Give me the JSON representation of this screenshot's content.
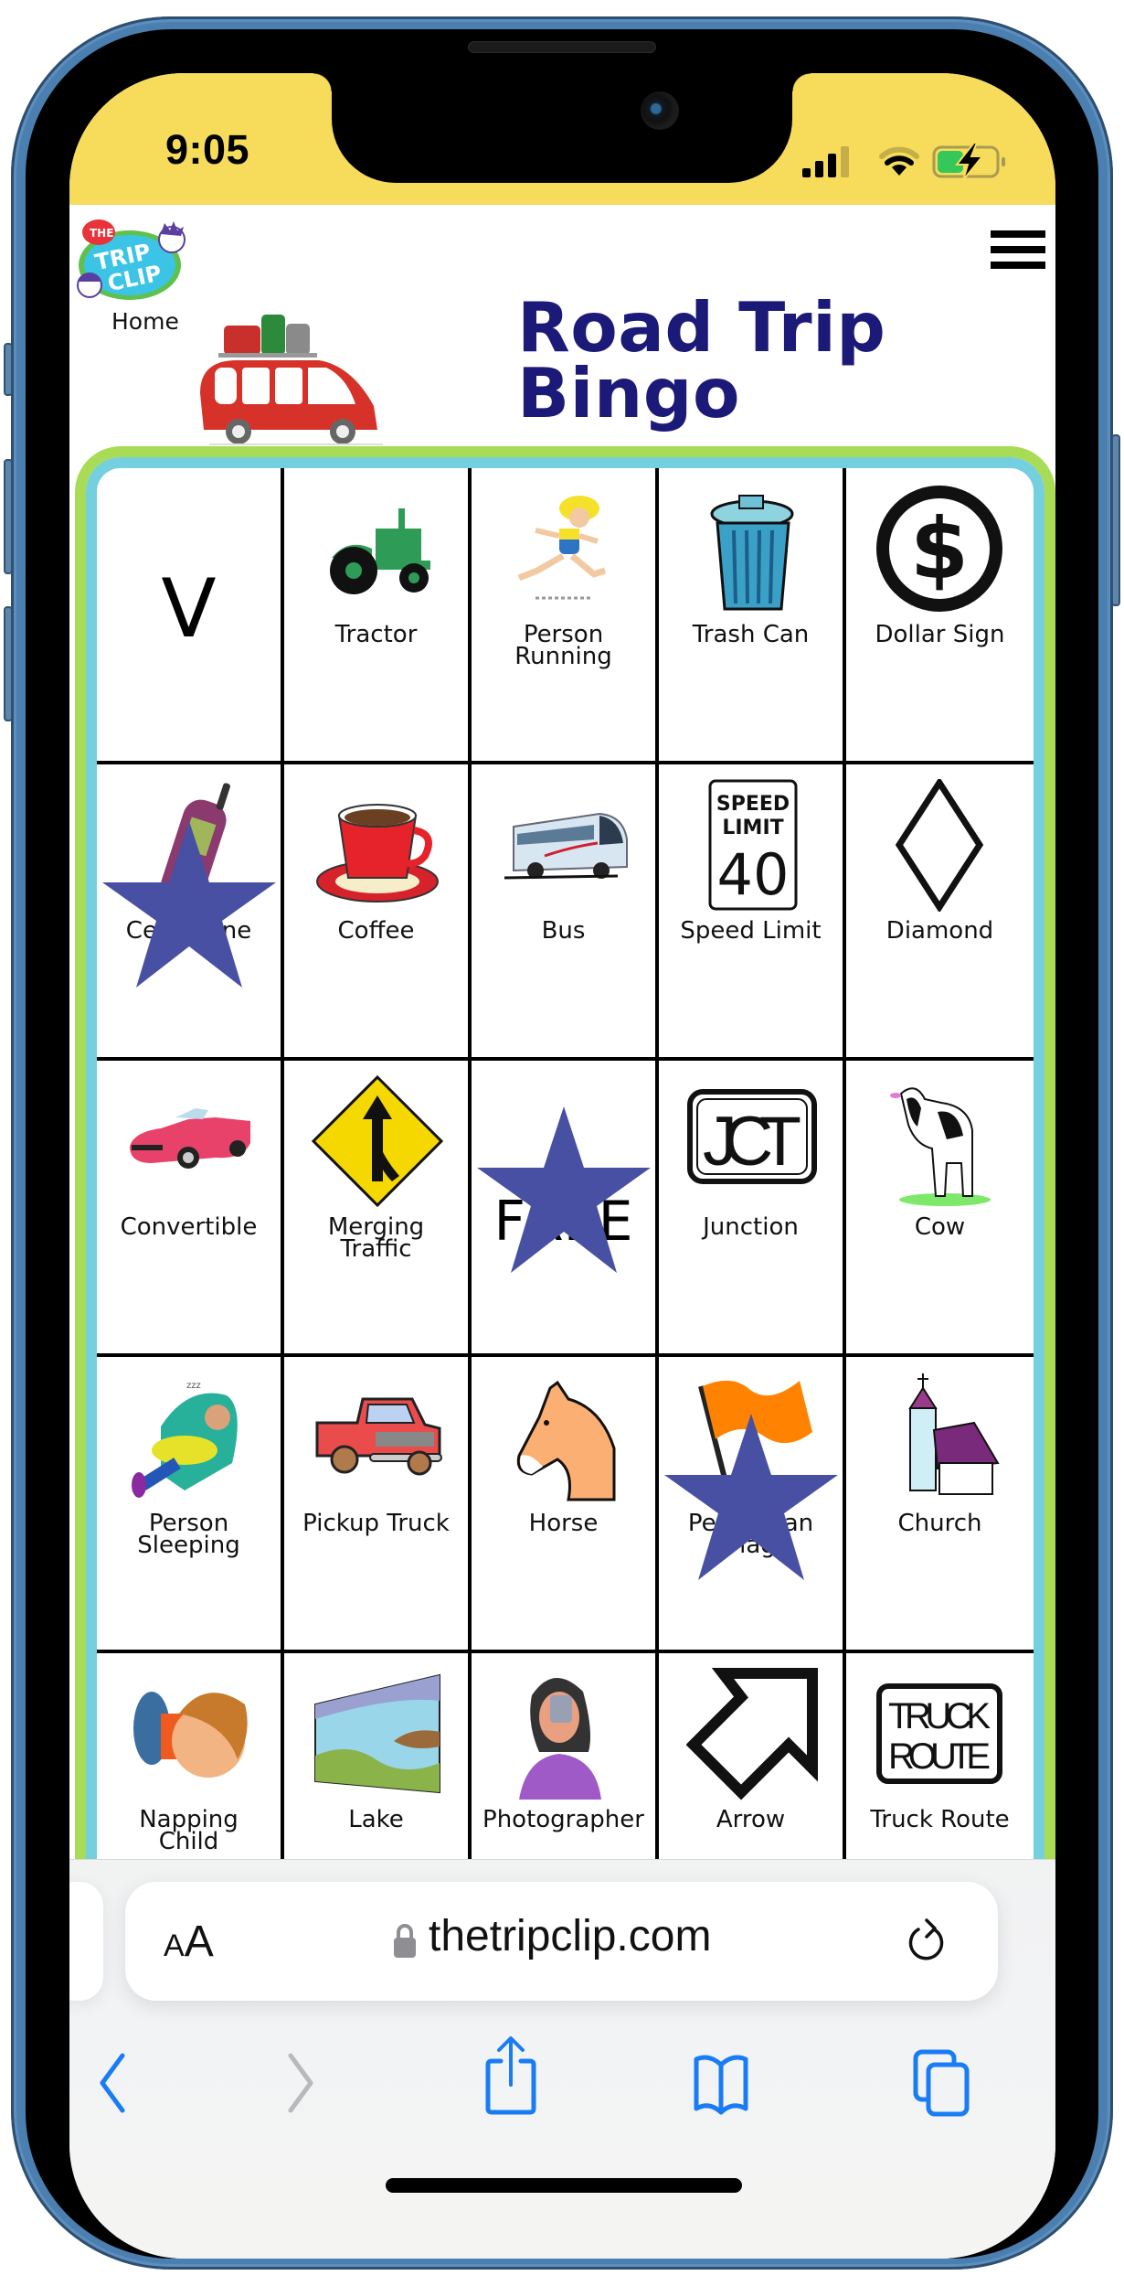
{
  "status_bar": {
    "time": "9:05",
    "signal_bars_active": 3,
    "signal_bars_total": 4,
    "wifi_arcs_active": 2,
    "wifi_arcs_total": 3,
    "battery_level": 0.45,
    "battery_charging": true,
    "background_color": "#f7dc5b"
  },
  "header": {
    "logo_alt": "The Trip Clip",
    "logo_lines": [
      "THE",
      "TRIP",
      "CLIP"
    ],
    "home_link": "Home",
    "menu_icon": "hamburger-menu-icon",
    "title_line1": "Road Trip",
    "title_line2": "Bingo",
    "title_color": "#1c1a78",
    "hero_image": "red-car-with-luggage"
  },
  "board": {
    "outer_border_color": "#a8dc56",
    "inner_border_color": "#74cfdf",
    "marker_color": "#4750a3",
    "cells": [
      {
        "label": "V",
        "type": "letter",
        "icon": "letter-v",
        "marked": false
      },
      {
        "label": "Tractor",
        "type": "image",
        "icon": "tractor-icon",
        "marked": false
      },
      {
        "label": "Person\nRunning",
        "type": "image",
        "icon": "person-running-icon",
        "marked": false
      },
      {
        "label": "Trash Can",
        "type": "image",
        "icon": "trash-can-icon",
        "marked": false
      },
      {
        "label": "Dollar Sign",
        "type": "image",
        "icon": "dollar-sign-icon",
        "marked": false
      },
      {
        "label": "Cell Phone",
        "type": "image",
        "icon": "cell-phone-icon",
        "marked": true
      },
      {
        "label": "Coffee",
        "type": "image",
        "icon": "coffee-icon",
        "marked": false
      },
      {
        "label": "Bus",
        "type": "image",
        "icon": "bus-icon",
        "marked": false
      },
      {
        "label": "Speed Limit",
        "type": "image",
        "icon": "speed-limit-sign-icon",
        "marked": false,
        "sign_text": [
          "SPEED",
          "LIMIT",
          "40"
        ]
      },
      {
        "label": "Diamond",
        "type": "image",
        "icon": "diamond-icon",
        "marked": false
      },
      {
        "label": "Convertible",
        "type": "image",
        "icon": "convertible-car-icon",
        "marked": false
      },
      {
        "label": "Merging\nTraffic",
        "type": "image",
        "icon": "merging-traffic-sign-icon",
        "marked": false
      },
      {
        "label": "FREE",
        "type": "letter",
        "icon": "free-space",
        "marked": true
      },
      {
        "label": "Junction",
        "type": "image",
        "icon": "junction-sign-icon",
        "marked": false,
        "sign_text": [
          "JCT"
        ]
      },
      {
        "label": "Cow",
        "type": "image",
        "icon": "cow-icon",
        "marked": false
      },
      {
        "label": "Person\nSleeping",
        "type": "image",
        "icon": "person-sleeping-icon",
        "marked": false
      },
      {
        "label": "Pickup Truck",
        "type": "image",
        "icon": "pickup-truck-icon",
        "marked": false
      },
      {
        "label": "Horse",
        "type": "image",
        "icon": "horse-icon",
        "marked": false
      },
      {
        "label": "Pedestrian\nFlag",
        "type": "image",
        "icon": "pedestrian-flag-icon",
        "marked": true
      },
      {
        "label": "Church",
        "type": "image",
        "icon": "church-icon",
        "marked": false
      },
      {
        "label": "Napping\nChild",
        "type": "image",
        "icon": "napping-child-icon",
        "marked": false
      },
      {
        "label": "Lake",
        "type": "image",
        "icon": "lake-icon",
        "marked": false
      },
      {
        "label": "Photographer",
        "type": "image",
        "icon": "photographer-icon",
        "marked": false
      },
      {
        "label": "Arrow",
        "type": "image",
        "icon": "arrow-sign-icon",
        "marked": false
      },
      {
        "label": "Truck Route",
        "type": "image",
        "icon": "truck-route-sign-icon",
        "marked": false,
        "sign_text": [
          "TRUCK",
          "ROUTE"
        ]
      }
    ]
  },
  "browser": {
    "text_size_small": "A",
    "text_size_big": "A",
    "url": "thetripclip.com",
    "secure": true,
    "accent_color": "#1a7cf5",
    "disabled_color": "#b8b8bd",
    "toolbar": {
      "back": "back-chevron-icon",
      "forward": "forward-chevron-icon",
      "share": "share-icon",
      "bookmarks": "bookmarks-book-icon",
      "tabs": "tabs-icon"
    }
  }
}
